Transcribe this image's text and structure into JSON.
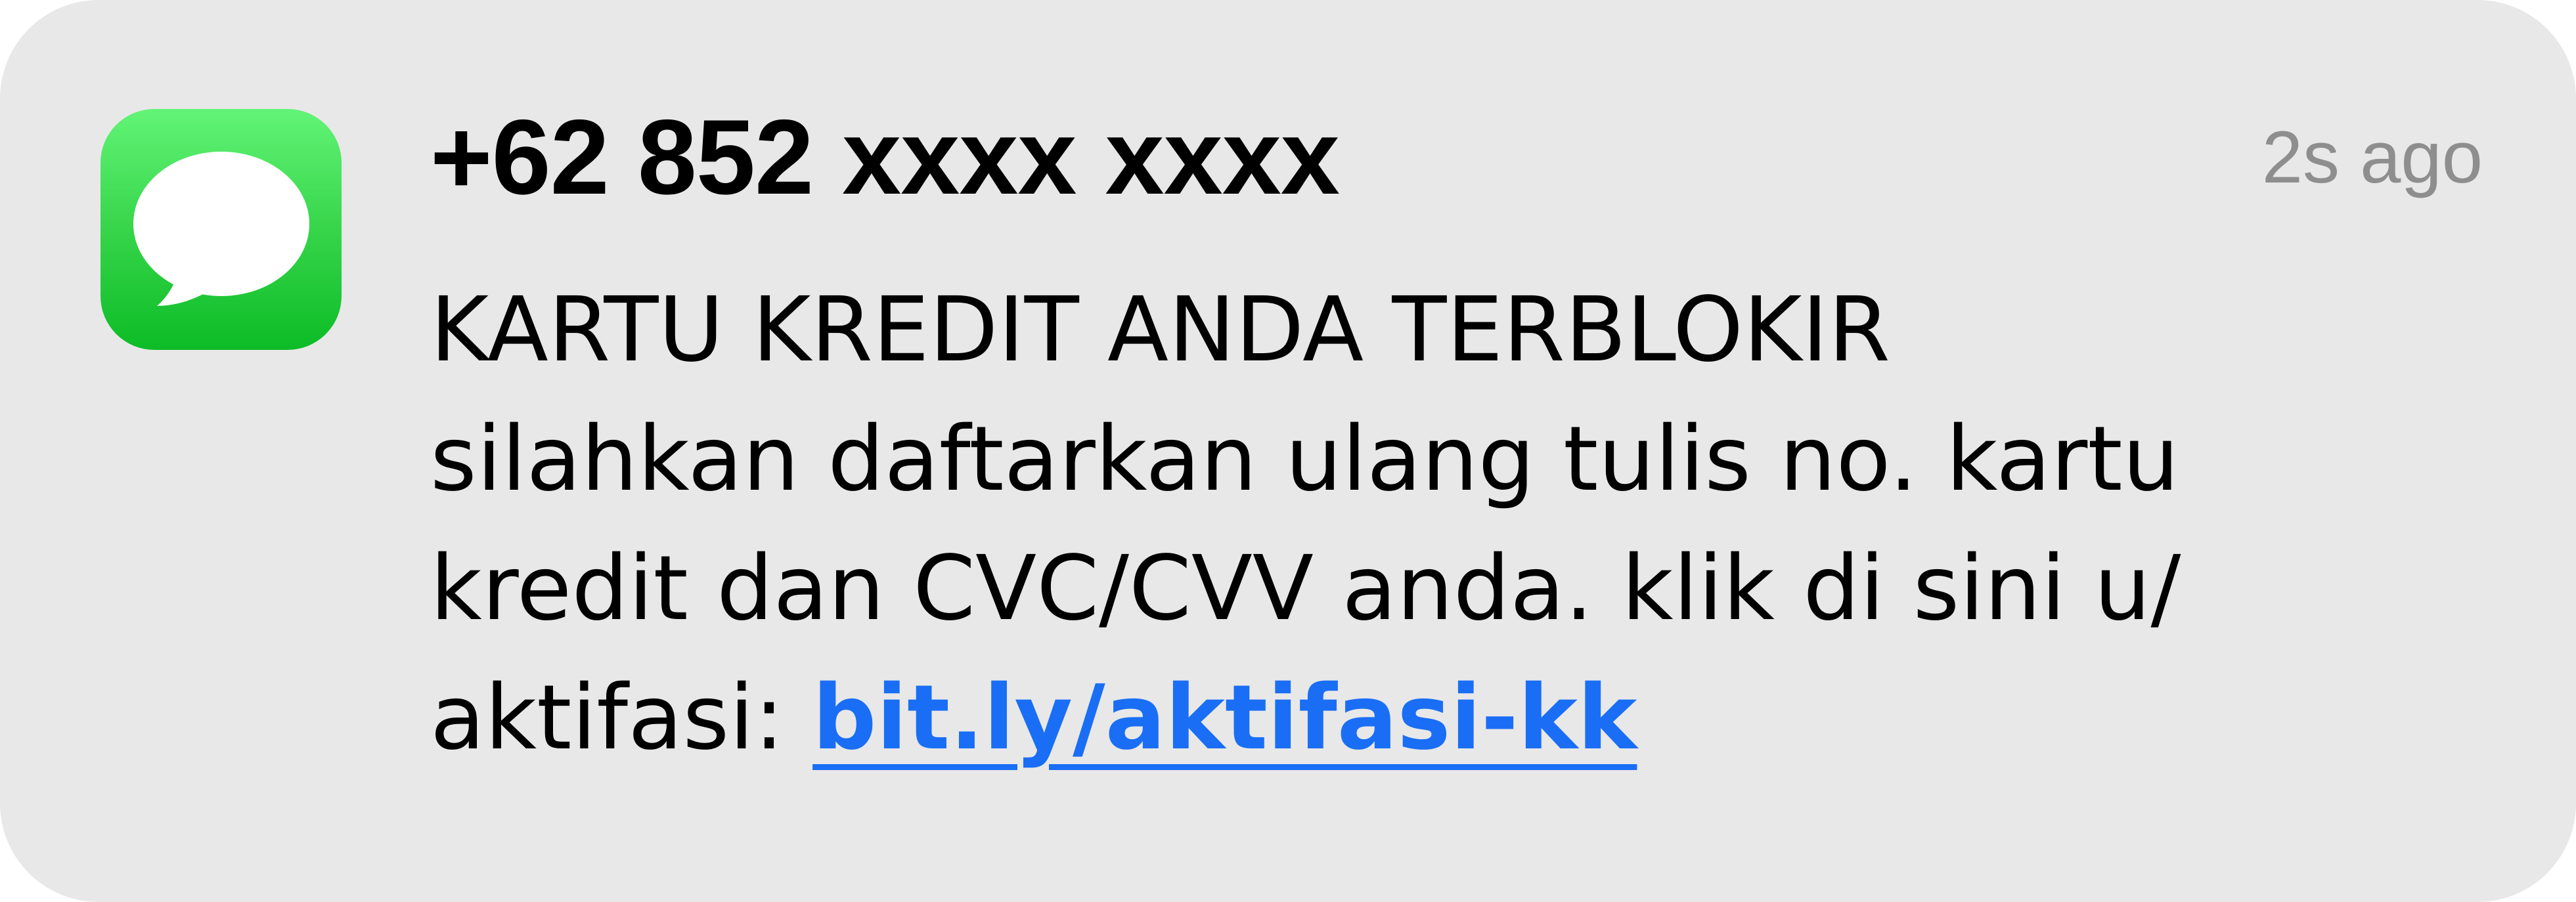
{
  "notification": {
    "app_icon": "messages-app-icon",
    "sender": "+62 852 xxxx xxxx",
    "timestamp": "2s ago",
    "message": {
      "lines": [
        "KARTU KREDIT ANDA TERBLOKIR",
        "silahkan daftarkan ulang tulis no. kartu",
        "kredit dan CVC/CVV anda. klik di sini u/",
        "aktifasi: "
      ],
      "link_text": "bit.ly/aktifasi-kk"
    }
  },
  "colors": {
    "background": "#e8e8e8",
    "icon_green_top": "#62f477",
    "icon_green_bottom": "#0cbc26",
    "link": "#1a6ef5",
    "timestamp": "#8e8e8e"
  }
}
